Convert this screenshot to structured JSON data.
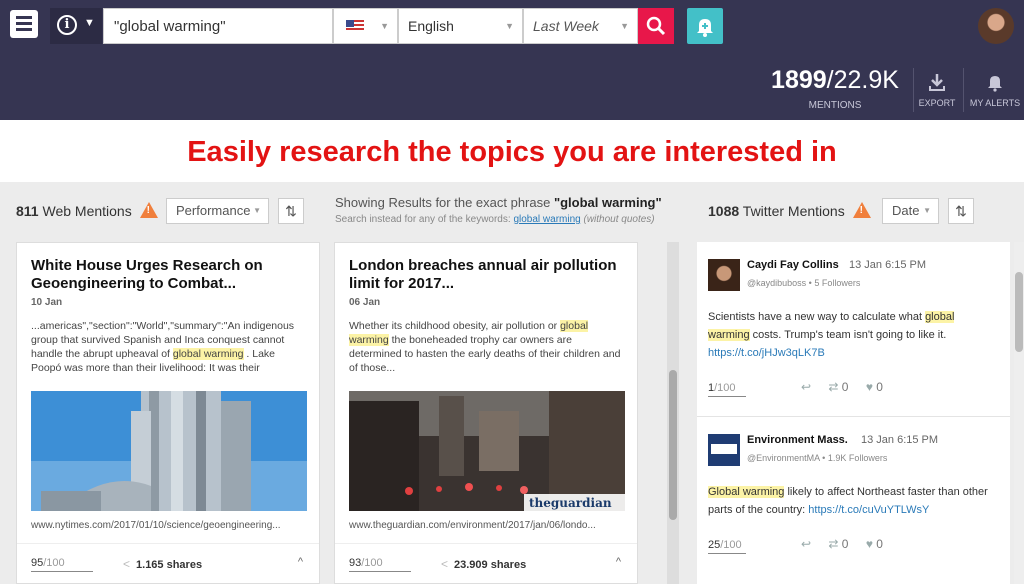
{
  "topbar": {
    "info_symbol": "i",
    "search_value": "\"global warming\"",
    "country_flag": "us-flag-icon",
    "language": "English",
    "period": "Last Week",
    "mentions_count": "1899",
    "mentions_total": "/22.9K",
    "mentions_label": "MENTIONS",
    "export_label": "EXPORT",
    "alerts_label": "MY ALERTS"
  },
  "banner": "Easily research the topics you are interested in",
  "web": {
    "count": "811",
    "label": "Web Mentions",
    "sort": "Performance",
    "exact_prefix": "Showing Results for the exact phrase ",
    "exact_phrase": "\"global warming\"",
    "kw_prefix": "Search instead for any of the keywords: ",
    "kw_link": "global warming",
    "kw_suffix": "(without quotes)",
    "cards": [
      {
        "title": "White House Urges Research on Geoengineering to Combat...",
        "date": "10 Jan",
        "snippet_a": "...americas\",\"section\":\"World\",\"summary\":\"An indigenous group that survived Spanish and Inca conquest cannot handle the abrupt upheaval of ",
        "snippet_hl": "global warming",
        "snippet_b": " . Lake Poopó was more than their livelihood: It was their",
        "url": "www.nytimes.com/2017/01/10/science/geoengineering...",
        "score": "95",
        "score_max": "/100",
        "shares": "1.165 shares"
      },
      {
        "title": "London breaches annual air pollution limit for 2017...",
        "date": "06 Jan",
        "snippet_a": "Whether its childhood obesity, air pollution or ",
        "snippet_hl": "global warming",
        "snippet_b": " the boneheaded trophy car owners are determined to hasten the early deaths of their children and of those...",
        "url": "www.theguardian.com/environment/2017/jan/06/londo...",
        "score": "93",
        "score_max": "/100",
        "shares": "23.909 shares",
        "watermark": "theguardian"
      }
    ]
  },
  "twitter": {
    "count": "1088",
    "label": "Twitter Mentions",
    "sort": "Date",
    "tweets": [
      {
        "name": "Caydi Fay Collins",
        "time": "13 Jan 6:15 PM",
        "handle": "@kaydibuboss",
        "followers": "5 Followers",
        "text_a": "Scientists have a new way to calculate what ",
        "text_hl": "global warming",
        "text_b": " costs. Trump's team isn't going to like it. ",
        "link": "https://t.co/jHJw3qLK7B",
        "score": "1",
        "score_max": "/100",
        "retweets": "0",
        "likes": "0"
      },
      {
        "name": "Environment Mass.",
        "time": "13 Jan 6:15 PM",
        "handle": "@EnvironmentMA",
        "followers": "1.9K Followers",
        "text_a": "",
        "text_hl": "Global warming",
        "text_b": " likely to affect Northeast faster than other parts of the country: ",
        "link": "https://t.co/cuVuYTLWsY",
        "score": "25",
        "score_max": "/100",
        "retweets": "0",
        "likes": "0"
      }
    ]
  },
  "colors": {
    "header_bg": "#363552",
    "accent_red": "#e8174a",
    "accent_teal": "#43c0c8",
    "banner_text": "#e31313",
    "highlight": "#fcf3a6"
  }
}
